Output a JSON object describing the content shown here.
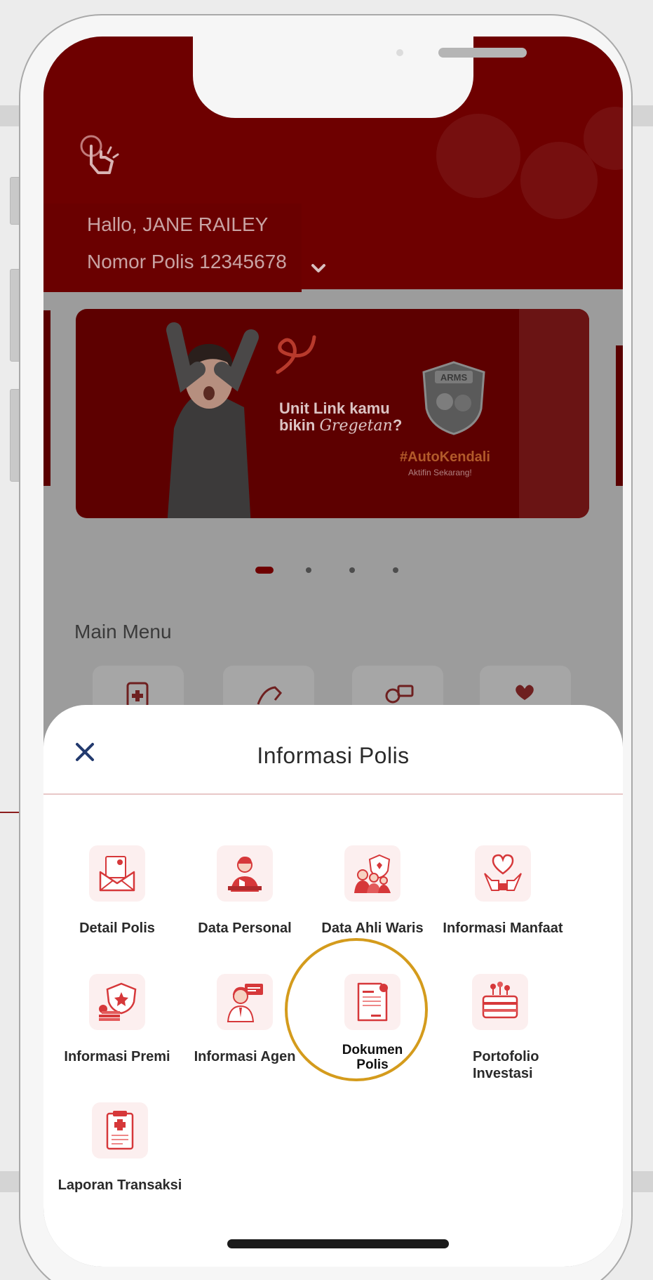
{
  "header": {
    "greeting": "Hallo, JANE RAILEY",
    "policy_number": "Nomor Polis 12345678"
  },
  "banner": {
    "headline_line1": "Unit Link kamu",
    "headline_line2_a": "bikin",
    "headline_line2_script": "Gregetan",
    "headline_line2_b": "?",
    "badge": "ARMS",
    "tagline": "#AutoKendali",
    "cta": "Aktifin Sekarang!"
  },
  "carousel": {
    "active_index": 0,
    "count": 4
  },
  "main_menu": {
    "title": "Main Menu"
  },
  "sheet": {
    "title": "Informasi Polis",
    "items": [
      {
        "label": "Detail Polis",
        "icon": "envelope-document-icon"
      },
      {
        "label": "Data Personal",
        "icon": "person-id-icon"
      },
      {
        "label": "Data Ahli Waris",
        "icon": "family-shield-icon"
      },
      {
        "label": "Informasi Manfaat",
        "icon": "hands-heart-icon"
      },
      {
        "label": "Informasi Premi",
        "icon": "coins-shield-icon"
      },
      {
        "label": "Informasi Agen",
        "icon": "agent-icon"
      },
      {
        "label_line1": "Dokumen",
        "label_line2": "Polis",
        "icon": "document-icon",
        "highlighted": true
      },
      {
        "label_line1": "Portofolio",
        "label_line2": "Investasi",
        "icon": "investment-wallet-icon"
      },
      {
        "label": "Laporan Transaksi",
        "icon": "medical-clipboard-icon"
      }
    ]
  },
  "colors": {
    "brand_red": "#6e0000",
    "icon_red": "#d6383a",
    "highlight_ring": "#d49b1c"
  }
}
